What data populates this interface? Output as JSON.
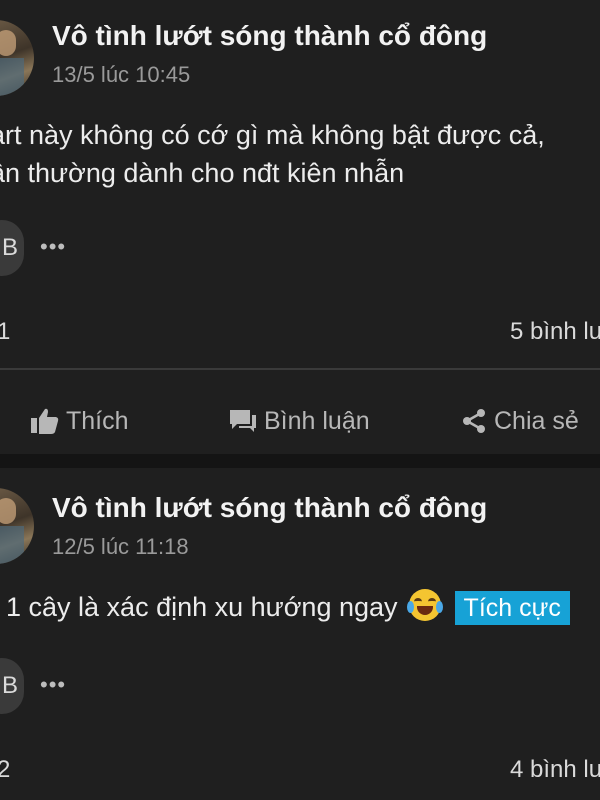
{
  "posts": [
    {
      "author": "Vô tình lướt sóng thành cổ đông",
      "time": "13/5 lúc 10:45",
      "content_line1": "art này không có cớ gì mà không bật được cả,",
      "content_line2": "ần thường dành cho nđt kiên nhẫn",
      "reactor_initial": "B",
      "more": "•••",
      "reaction_count": "1",
      "comment_count": "5 bình lu"
    },
    {
      "author": "Vô tình lướt sóng thành cổ đông",
      "time": "12/5 lúc 11:18",
      "content": "1 cây là xác định xu hướng ngay",
      "emoji": "face-with-tears-of-joy-icon",
      "tag": "Tích cực",
      "reactor_initial": "B",
      "more": "•••",
      "reaction_count": "2",
      "comment_count": "4 bình lu"
    }
  ],
  "actions": {
    "like": "Thích",
    "comment": "Bình luận",
    "share": "Chia sẻ"
  },
  "colors": {
    "background": "#1f1f1f",
    "tag_bg": "#17a2d6",
    "muted": "#9a9a9a"
  }
}
